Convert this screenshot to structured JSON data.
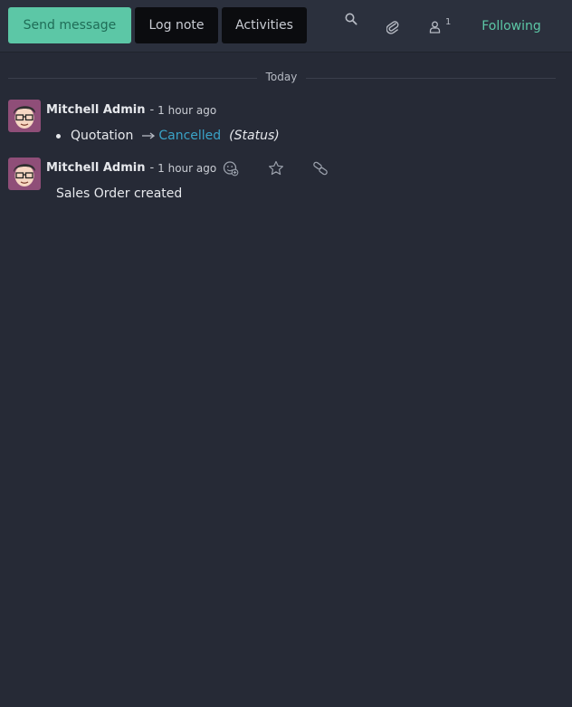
{
  "toolbar": {
    "send_message": "Send message",
    "log_note": "Log note",
    "activities": "Activities",
    "followers_count": "1",
    "following": "Following"
  },
  "thread": {
    "date_separator": "Today",
    "messages": [
      {
        "author": "Mitchell Admin",
        "separator": "-",
        "time": "1 hour ago",
        "tracking": {
          "old_value": "Quotation",
          "new_value": "Cancelled",
          "field": "(Status)"
        }
      },
      {
        "author": "Mitchell Admin",
        "separator": "-",
        "time": "1 hour ago",
        "body": "Sales Order created"
      }
    ]
  },
  "colors": {
    "accent": "#5cc7a6",
    "link": "#3aa3c7",
    "background": "#262a36",
    "topbar": "#2b303d"
  },
  "icons": [
    "search-icon",
    "paperclip-icon",
    "user-icon",
    "add-reaction-icon",
    "star-icon",
    "link-icon"
  ]
}
